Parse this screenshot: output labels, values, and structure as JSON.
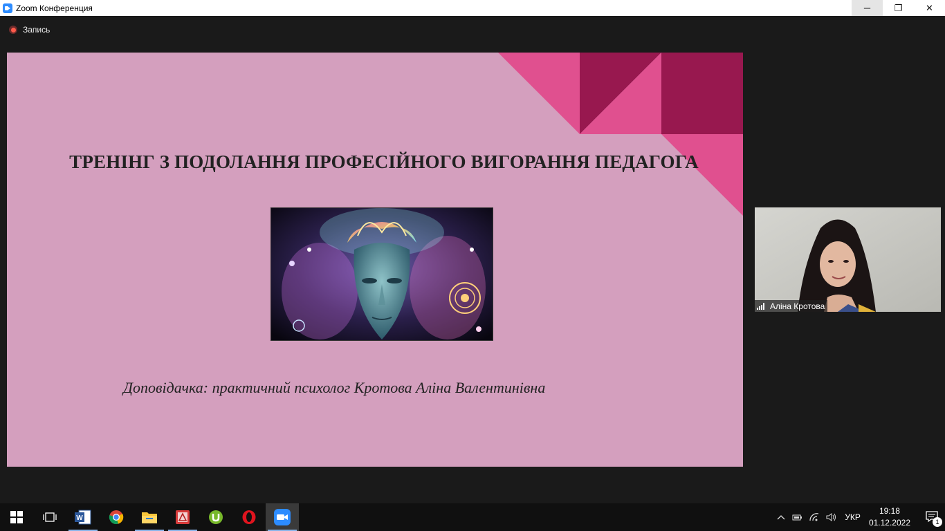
{
  "window": {
    "title": "Zoom Конференция",
    "controls": {
      "minimize": "─",
      "restore": "❐",
      "close": "✕"
    }
  },
  "recording": {
    "label": "Запись"
  },
  "slide": {
    "title": "ТРЕНІНГ З ПОДОЛАННЯ ПРОФЕСІЙНОГО ВИГОРАННЯ ПЕДАГОГА",
    "subtitle": "Доповідачка: практичний психолог Кротова Аліна Валентинівна",
    "colors": {
      "background": "#d49fbe",
      "accent_pink": "#e0508f",
      "accent_dark": "#98184f"
    }
  },
  "participant": {
    "name": "Аліна Кротова",
    "signal_icon": "signal-bars-icon"
  },
  "taskbar": {
    "apps": [
      {
        "name": "windows-start",
        "icon": "windows-logo-icon"
      },
      {
        "name": "task-view",
        "icon": "task-view-icon"
      },
      {
        "name": "word",
        "icon": "word-icon"
      },
      {
        "name": "chrome",
        "icon": "chrome-icon"
      },
      {
        "name": "file-explorer",
        "icon": "folder-icon"
      },
      {
        "name": "pdf-app",
        "icon": "pdf-icon"
      },
      {
        "name": "utorrent",
        "icon": "utorrent-icon"
      },
      {
        "name": "opera",
        "icon": "opera-icon"
      },
      {
        "name": "zoom",
        "icon": "zoom-icon"
      }
    ],
    "tray": {
      "language": "УКР",
      "time": "19:18",
      "date": "01.12.2022",
      "notifications_count": "1"
    }
  }
}
